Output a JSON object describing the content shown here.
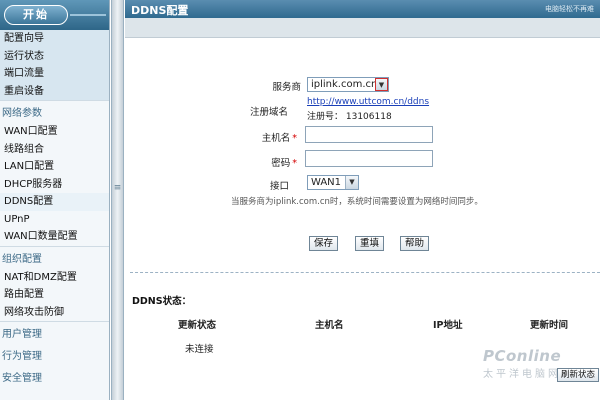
{
  "sidebar": {
    "start_label": "开始",
    "groups": [
      {
        "items": [
          "配置向导",
          "运行状态",
          "端口流量",
          "重启设备"
        ]
      },
      {
        "heading": "网络参数",
        "items": [
          "WAN口配置",
          "线路组合",
          "LAN口配置",
          "DHCP服务器",
          "DDNS配置",
          "UPnP",
          "WAN口数量配置"
        ]
      },
      {
        "heading": "组织配置",
        "items": [
          "NAT和DMZ配置",
          "路由配置",
          "网络攻击防御"
        ]
      },
      {
        "heading": "用户管理",
        "items": []
      },
      {
        "heading": "行为管理",
        "items": []
      },
      {
        "heading": "安全管理",
        "items": []
      }
    ]
  },
  "page": {
    "title": "DDNS配置",
    "top_right_text": "电脑轻松不再难"
  },
  "form": {
    "provider_label": "服务商",
    "provider_value": "iplink.com.cn",
    "domain_label": "注册域名",
    "domain_link": "http://www.uttcom.cn/ddns",
    "reg_number": "注册号： 13106118",
    "hostname_label": "主机名",
    "hostname_value": "",
    "password_label": "密码",
    "password_value": "",
    "port_label": "接口",
    "port_value": "WAN1",
    "note": "当服务商为iplink.com.cn时，系统时间需要设置为网络时间同步。",
    "required_mark": "*",
    "buttons": {
      "save": "保存",
      "reset": "重填",
      "help": "帮助"
    }
  },
  "status": {
    "title": "DDNS状态：",
    "columns": [
      "更新状态",
      "主机名",
      "IP地址",
      "更新时间"
    ],
    "row": {
      "update_status": "未连接"
    },
    "refresh_label": "刷新状态"
  },
  "watermark": {
    "brand": "PConline",
    "sub": "太平洋电脑网"
  },
  "icons": {
    "dropdown": "chevron-down-icon",
    "splitter": "collapse-handle-icon"
  },
  "colors": {
    "title_bar": "#2f6a8f",
    "required": "#d40000",
    "link": "#1a3fb8"
  }
}
